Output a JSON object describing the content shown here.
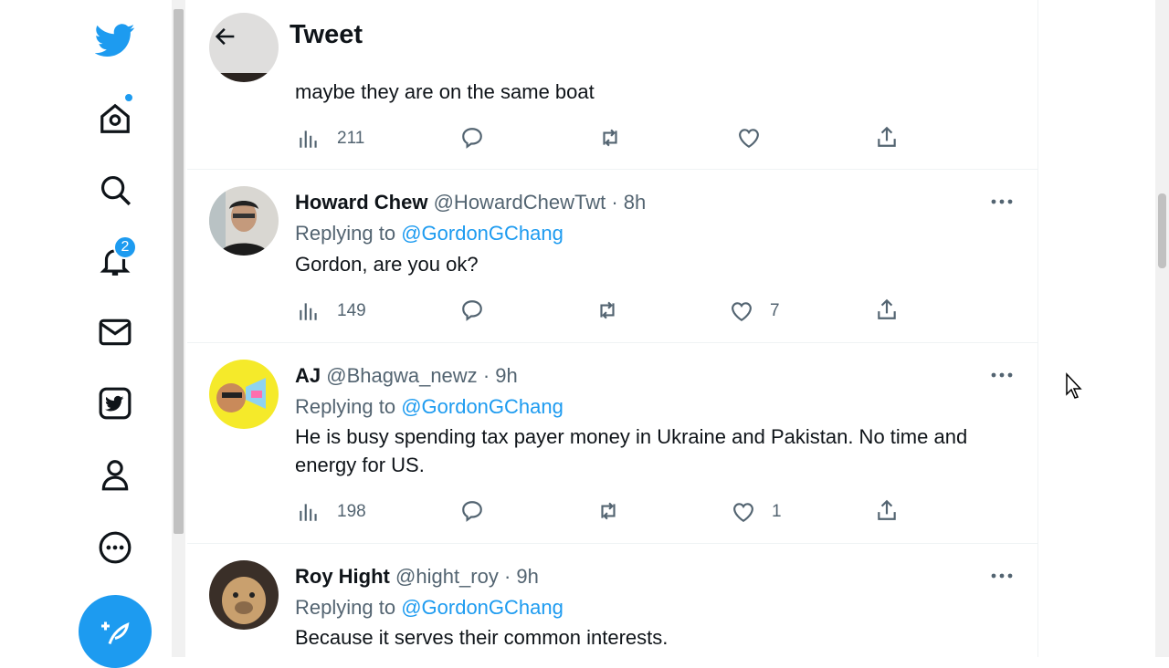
{
  "header": {
    "title": "Tweet"
  },
  "sidebar": {
    "notification_count": "2"
  },
  "tweets": [
    {
      "text": "maybe they are on the same boat",
      "views": "211",
      "likes": ""
    },
    {
      "name": "Howard Chew",
      "handle": "@HowardChewTwt",
      "time": "· 8h",
      "reply_prefix": "Replying to",
      "reply_to": "@GordonGChang",
      "text": "Gordon, are you ok?",
      "views": "149",
      "likes": "7"
    },
    {
      "name": "AJ",
      "handle": "@Bhagwa_newz",
      "time": "· 9h",
      "reply_prefix": "Replying to",
      "reply_to": "@GordonGChang",
      "text": "He is busy spending tax payer money in Ukraine and Pakistan. No time and energy for US.",
      "views": "198",
      "likes": "1"
    },
    {
      "name": "Roy Hight",
      "handle": "@hight_roy",
      "time": "· 9h",
      "reply_prefix": "Replying to",
      "reply_to": "@GordonGChang",
      "text": "Because it serves their common interests."
    }
  ],
  "colors": {
    "accent": "#1d9bf0",
    "text": "#0f1419",
    "muted": "#536471"
  }
}
